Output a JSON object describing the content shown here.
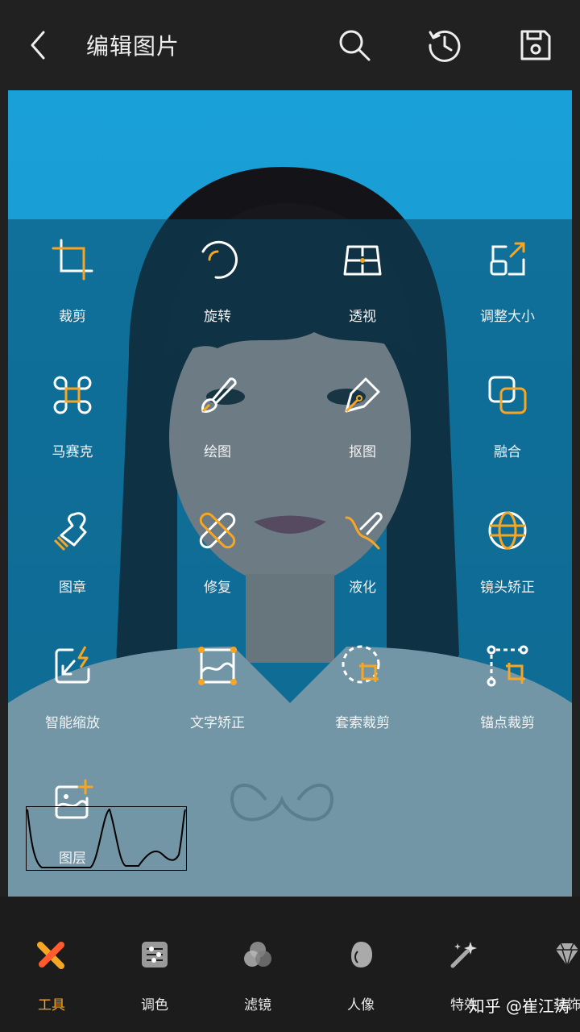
{
  "header": {
    "title": "编辑图片",
    "icons": [
      "back-icon",
      "search-icon",
      "history-icon",
      "save-icon"
    ]
  },
  "tools": [
    {
      "label": "裁剪",
      "icon": "crop-icon"
    },
    {
      "label": "旋转",
      "icon": "rotate-icon"
    },
    {
      "label": "透视",
      "icon": "perspective-icon"
    },
    {
      "label": "调整大小",
      "icon": "resize-icon"
    },
    {
      "label": "马赛克",
      "icon": "mosaic-icon"
    },
    {
      "label": "绘图",
      "icon": "brush-icon"
    },
    {
      "label": "抠图",
      "icon": "cutout-pen-icon"
    },
    {
      "label": "融合",
      "icon": "blend-icon"
    },
    {
      "label": "图章",
      "icon": "stamp-icon"
    },
    {
      "label": "修复",
      "icon": "bandage-icon"
    },
    {
      "label": "液化",
      "icon": "liquify-icon"
    },
    {
      "label": "镜头矫正",
      "icon": "lens-globe-icon"
    },
    {
      "label": "智能缩放",
      "icon": "smart-zoom-icon"
    },
    {
      "label": "文字矫正",
      "icon": "text-correct-icon"
    },
    {
      "label": "套索裁剪",
      "icon": "lasso-crop-icon"
    },
    {
      "label": "锚点裁剪",
      "icon": "anchor-crop-icon"
    },
    {
      "label": "图层",
      "icon": "layer-add-icon"
    }
  ],
  "bottom_tabs": [
    {
      "label": "工具",
      "icon": "tools-icon",
      "active": true
    },
    {
      "label": "调色",
      "icon": "sliders-icon",
      "active": false
    },
    {
      "label": "滤镜",
      "icon": "filter-icon",
      "active": false
    },
    {
      "label": "人像",
      "icon": "portrait-icon",
      "active": false
    },
    {
      "label": "特效",
      "icon": "magic-wand-icon",
      "active": false
    },
    {
      "label": "装饰",
      "icon": "diamond-icon",
      "active": false
    }
  ],
  "watermark": "知乎 @崔江涛",
  "colors": {
    "accent": "#f6a623",
    "overlay": "#0b5777",
    "bg": "#212121"
  }
}
